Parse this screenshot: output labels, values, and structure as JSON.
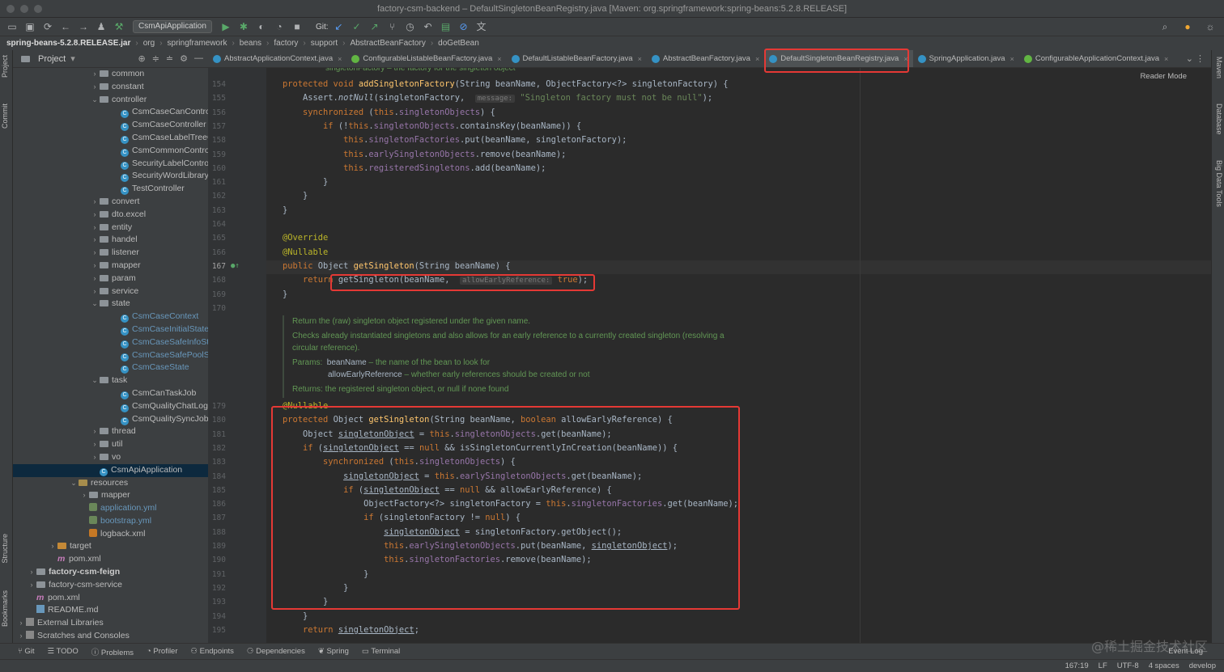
{
  "window": {
    "title": "factory-csm-backend – DefaultSingletonBeanRegistry.java [Maven: org.springframework:spring-beans:5.2.8.RELEASE]"
  },
  "toolbar": {
    "run_config": "CsmApiApplication",
    "git_label": "Git:"
  },
  "breadcrumbs": [
    "spring-beans-5.2.8.RELEASE.jar",
    "org",
    "springframework",
    "beans",
    "factory",
    "support",
    "AbstractBeanFactory",
    "doGetBean"
  ],
  "left_strip": {
    "project": "Project",
    "commit": "Commit",
    "structure": "Structure",
    "bookmarks": "Bookmarks"
  },
  "right_strip": {
    "maven": "Maven",
    "database": "Database",
    "bigdata": "Big Data Tools"
  },
  "project_panel": {
    "title": "Project",
    "items": [
      {
        "label": "common",
        "type": "folder",
        "indent": 7,
        "arrow": "›"
      },
      {
        "label": "constant",
        "type": "folder",
        "indent": 7,
        "arrow": "›"
      },
      {
        "label": "controller",
        "type": "folder",
        "indent": 7,
        "arrow": "⌄"
      },
      {
        "label": "CsmCaseCanControlle",
        "type": "class",
        "indent": 9
      },
      {
        "label": "CsmCaseController",
        "type": "class",
        "indent": 9
      },
      {
        "label": "CsmCaseLabelTreeCo",
        "type": "class",
        "indent": 9
      },
      {
        "label": "CsmCommonControlle",
        "type": "class",
        "indent": 9
      },
      {
        "label": "SecurityLabelControlle",
        "type": "class",
        "indent": 9
      },
      {
        "label": "SecurityWordLibraryC",
        "type": "class",
        "indent": 9
      },
      {
        "label": "TestController",
        "type": "class",
        "indent": 9
      },
      {
        "label": "convert",
        "type": "folder",
        "indent": 7,
        "arrow": "›"
      },
      {
        "label": "dto.excel",
        "type": "folder",
        "indent": 7,
        "arrow": "›"
      },
      {
        "label": "entity",
        "type": "folder",
        "indent": 7,
        "arrow": "›"
      },
      {
        "label": "handel",
        "type": "folder",
        "indent": 7,
        "arrow": "›"
      },
      {
        "label": "listener",
        "type": "folder",
        "indent": 7,
        "arrow": "›"
      },
      {
        "label": "mapper",
        "type": "folder",
        "indent": 7,
        "arrow": "›"
      },
      {
        "label": "param",
        "type": "folder",
        "indent": 7,
        "arrow": "›"
      },
      {
        "label": "service",
        "type": "folder",
        "indent": 7,
        "arrow": "›"
      },
      {
        "label": "state",
        "type": "folder",
        "indent": 7,
        "arrow": "⌄"
      },
      {
        "label": "CsmCaseContext",
        "type": "class-blue",
        "indent": 9
      },
      {
        "label": "CsmCaseInitialState",
        "type": "class-blue",
        "indent": 9
      },
      {
        "label": "CsmCaseSafeInfoState",
        "type": "class-blue",
        "indent": 9
      },
      {
        "label": "CsmCaseSafePoolStat",
        "type": "class-blue",
        "indent": 9
      },
      {
        "label": "CsmCaseState",
        "type": "class-blue",
        "indent": 9
      },
      {
        "label": "task",
        "type": "folder",
        "indent": 7,
        "arrow": "⌄"
      },
      {
        "label": "CsmCanTaskJob",
        "type": "class",
        "indent": 9
      },
      {
        "label": "CsmQualityChatLogJo",
        "type": "class",
        "indent": 9
      },
      {
        "label": "CsmQualitySyncJob",
        "type": "class",
        "indent": 9
      },
      {
        "label": "thread",
        "type": "folder",
        "indent": 7,
        "arrow": "›"
      },
      {
        "label": "util",
        "type": "folder",
        "indent": 7,
        "arrow": "›"
      },
      {
        "label": "vo",
        "type": "folder",
        "indent": 7,
        "arrow": "›"
      },
      {
        "label": "CsmApiApplication",
        "type": "class",
        "indent": 7,
        "selected": true
      },
      {
        "label": "resources",
        "type": "folder-res",
        "indent": 5,
        "arrow": "⌄"
      },
      {
        "label": "mapper",
        "type": "folder",
        "indent": 6,
        "arrow": "›"
      },
      {
        "label": "application.yml",
        "type": "yml",
        "indent": 6
      },
      {
        "label": "bootstrap.yml",
        "type": "yml",
        "indent": 6
      },
      {
        "label": "logback.xml",
        "type": "xml",
        "indent": 6
      },
      {
        "label": "target",
        "type": "folder-orange",
        "indent": 3,
        "arrow": "›"
      },
      {
        "label": "pom.xml",
        "type": "maven",
        "indent": 3
      },
      {
        "label": "factory-csm-feign",
        "type": "folder-bold",
        "indent": 1,
        "arrow": "›"
      },
      {
        "label": "factory-csm-service",
        "type": "folder",
        "indent": 1,
        "arrow": "›"
      },
      {
        "label": "pom.xml",
        "type": "maven",
        "indent": 1
      },
      {
        "label": "README.md",
        "type": "md",
        "indent": 1
      },
      {
        "label": "External Libraries",
        "type": "lib",
        "indent": 0,
        "arrow": "›"
      },
      {
        "label": "Scratches and Consoles",
        "type": "lib",
        "indent": 0,
        "arrow": "›"
      }
    ]
  },
  "tabs": [
    {
      "label": "AbstractApplicationContext.java",
      "icon": "class"
    },
    {
      "label": "ConfigurableListableBeanFactory.java",
      "icon": "interface"
    },
    {
      "label": "DefaultListableBeanFactory.java",
      "icon": "class"
    },
    {
      "label": "AbstractBeanFactory.java",
      "icon": "class"
    },
    {
      "label": "DefaultSingletonBeanRegistry.java",
      "icon": "class",
      "active": true
    },
    {
      "label": "SpringApplication.java",
      "icon": "class"
    },
    {
      "label": "ConfigurableApplicationContext.java",
      "icon": "interface"
    }
  ],
  "editor": {
    "reader_mode": "Reader Mode",
    "top_partial": "singletonFactory – the factory for the singleton object",
    "doc": {
      "summary": "Return the (raw) singleton object registered under the given name.",
      "detail": "Checks already instantiated singletons and also allows for an early reference to a currently created singleton (resolving a circular reference).",
      "params_label": "Params:",
      "param1_name": "beanName",
      "param1_desc": " – the name of the bean to look for",
      "param2_name": "allowEarlyReference",
      "param2_desc": " – whether early references should be created or not",
      "returns_label": "Returns:",
      "returns_desc": "the registered singleton object, or null if none found"
    },
    "line_numbers": [
      "154",
      "155",
      "156",
      "157",
      "158",
      "159",
      "160",
      "161",
      "162",
      "163",
      "164",
      "165",
      "166",
      "167",
      "168",
      "169",
      "170",
      "179",
      "180",
      "181",
      "182",
      "183",
      "184",
      "185",
      "186",
      "187",
      "188",
      "189",
      "190",
      "191",
      "192",
      "193",
      "194",
      "195"
    ]
  },
  "bottom_tools": [
    "Git",
    "TODO",
    "Problems",
    "Profiler",
    "Endpoints",
    "Dependencies",
    "Spring",
    "Terminal"
  ],
  "event_log": "Event Log",
  "status": {
    "position": "167:19",
    "line_sep": "LF",
    "encoding": "UTF-8",
    "indent": "4 spaces",
    "branch": "develop"
  },
  "watermark": "@稀土掘金技术社区"
}
